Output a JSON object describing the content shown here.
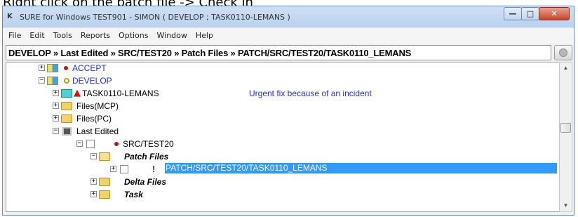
{
  "caption": "Right click on the patch file -> Check in",
  "window": {
    "app_icon": "K",
    "title": "SURE for Windows TEST901 - SIMON ( DEVELOP ; TASK0110-LEMANS )",
    "buttons": {
      "minimize": "—",
      "maximize": "□",
      "close": "✕"
    }
  },
  "menu": [
    "File",
    "Edit",
    "Tools",
    "Reports",
    "Options",
    "Window",
    "Help"
  ],
  "path": "DEVELOP » Last Edited » SRC/TEST20 » Patch Files » PATCH/SRC/TEST20/TASK0110_LEMANS",
  "tree": {
    "accept": "ACCEPT",
    "develop": "DEVELOP",
    "task": "TASK0110-LEMANS",
    "task_note": "Urgent fix because of an incident",
    "files_mcp": "Files(MCP)",
    "files_pc": "Files(PC)",
    "last_edited": "Last Edited",
    "src_test20": "SRC/TEST20",
    "patch_files": "Patch Files",
    "patch_item": "PATCH/SRC/TEST20/TASK0110_LEMANS",
    "delta_files": "Delta Files",
    "task_folder": "Task"
  },
  "colors": {
    "selection": "#3399ff",
    "link_blue": "#2036d8",
    "marker_red": "#c0141b"
  }
}
